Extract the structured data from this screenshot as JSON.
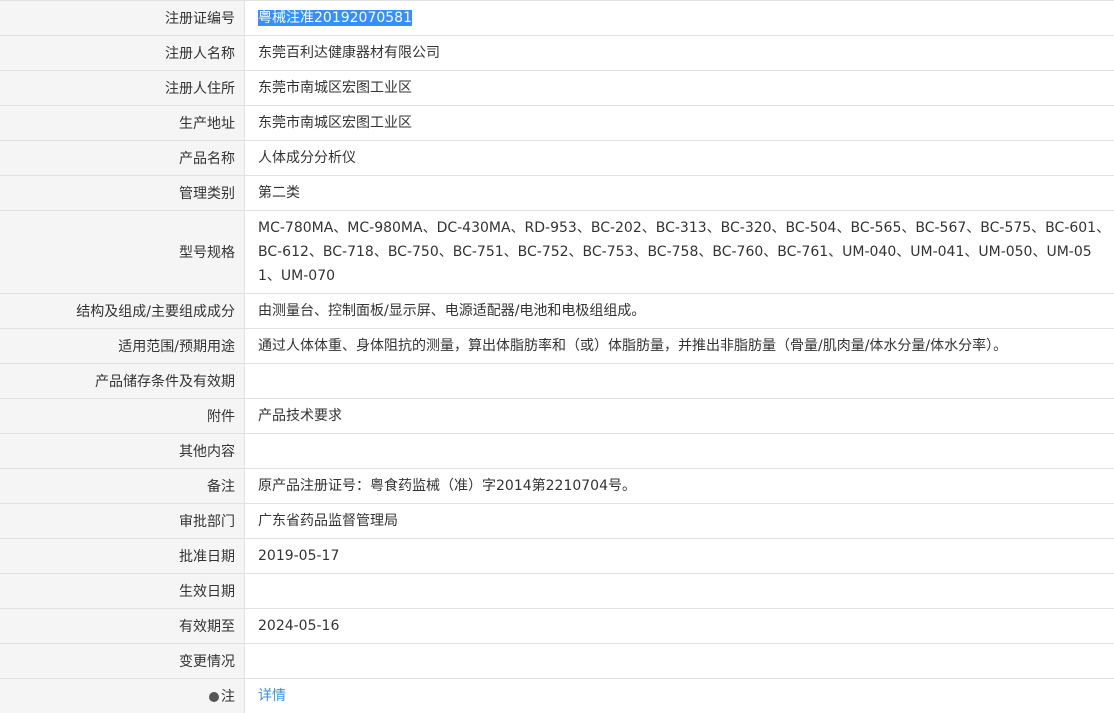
{
  "rows": [
    {
      "label": "注册证编号",
      "value": "粤械注准20192070581"
    },
    {
      "label": "注册人名称",
      "value": "东莞百利达健康器材有限公司"
    },
    {
      "label": "注册人住所",
      "value": "东莞市南城区宏图工业区"
    },
    {
      "label": "生产地址",
      "value": "东莞市南城区宏图工业区"
    },
    {
      "label": "产品名称",
      "value": "人体成分分析仪"
    },
    {
      "label": "管理类别",
      "value": "第二类"
    },
    {
      "label": "型号规格",
      "value": "MC-780MA、MC-980MA、DC-430MA、RD-953、BC-202、BC-313、BC-320、BC-504、BC-565、BC-567、BC-575、BC-601、BC-612、BC-718、BC-750、BC-751、BC-752、BC-753、BC-758、BC-760、BC-761、UM-040、UM-041、UM-050、UM-051、UM-070"
    },
    {
      "label": "结构及组成/主要组成成分",
      "value": "由测量台、控制面板/显示屏、电源适配器/电池和电极组组成。"
    },
    {
      "label": "适用范围/预期用途",
      "value": "通过人体体重、身体阻抗的测量，算出体脂肪率和（或）体脂肪量，并推出非脂肪量（骨量/肌肉量/体水分量/体水分率）。"
    },
    {
      "label": "产品储存条件及有效期",
      "value": ""
    },
    {
      "label": "附件",
      "value": "产品技术要求"
    },
    {
      "label": "其他内容",
      "value": ""
    },
    {
      "label": "备注",
      "value": "原产品注册证号：粤食药监械（准）字2014第2210704号。"
    },
    {
      "label": "审批部门",
      "value": "广东省药品监督管理局"
    },
    {
      "label": "批准日期",
      "value": "2019-05-17"
    },
    {
      "label": "生效日期",
      "value": ""
    },
    {
      "label": "有效期至",
      "value": "2024-05-16"
    },
    {
      "label": "变更情况",
      "value": ""
    },
    {
      "label": "注",
      "value": "详情"
    }
  ],
  "colors": {
    "label_bg": "#f5f5f5",
    "border": "#e1e1e1",
    "selection": "#3390ff",
    "link": "#3a8ee6"
  }
}
